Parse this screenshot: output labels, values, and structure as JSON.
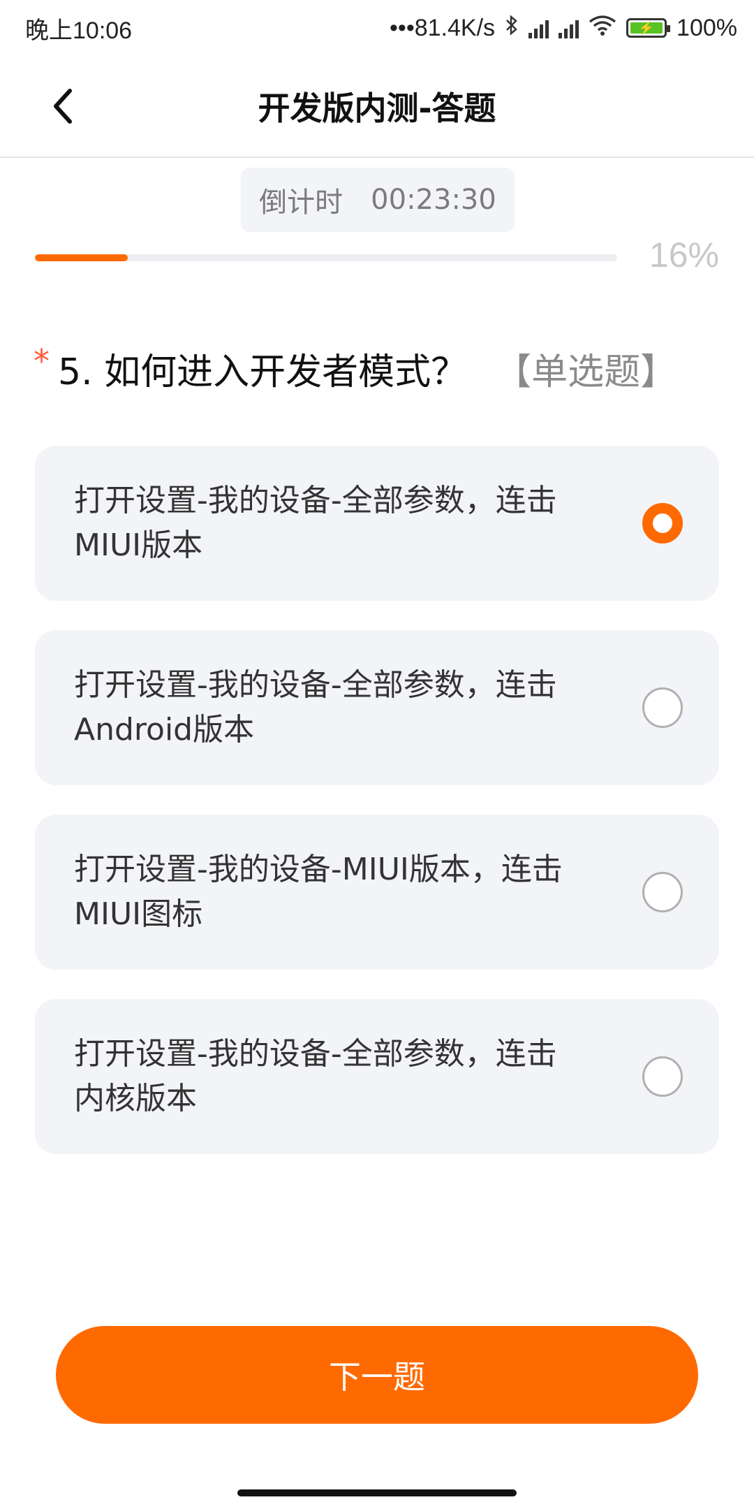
{
  "status_bar": {
    "time": "晚上10:06",
    "network_speed": "•••81.4K/s",
    "battery": "100%"
  },
  "header": {
    "title": "开发版内测-答题",
    "back_icon": "chevron-left-icon"
  },
  "countdown": {
    "label": "倒计时",
    "value": "00:23:30"
  },
  "progress": {
    "percent": 16,
    "label": "16%"
  },
  "question": {
    "required_mark": "*",
    "text": "5. 如何进入开发者模式？",
    "type": "【单选题】"
  },
  "options": [
    {
      "line1": "打开设置-我的设备-全部参数，连击",
      "line2": "MIUI版本",
      "selected": true
    },
    {
      "line1": "打开设置-我的设备-全部参数，连击",
      "line2": "Android版本",
      "selected": false
    },
    {
      "line1": "打开设置-我的设备-MIUI版本，连击",
      "line2": "MIUI图标",
      "selected": false
    },
    {
      "line1": "打开设置-我的设备-全部参数，连击",
      "line2": "内核版本",
      "selected": false
    }
  ],
  "next_button": {
    "label": "下一题"
  },
  "colors": {
    "accent": "#ff6a00",
    "option_bg": "#f3f4f8"
  }
}
